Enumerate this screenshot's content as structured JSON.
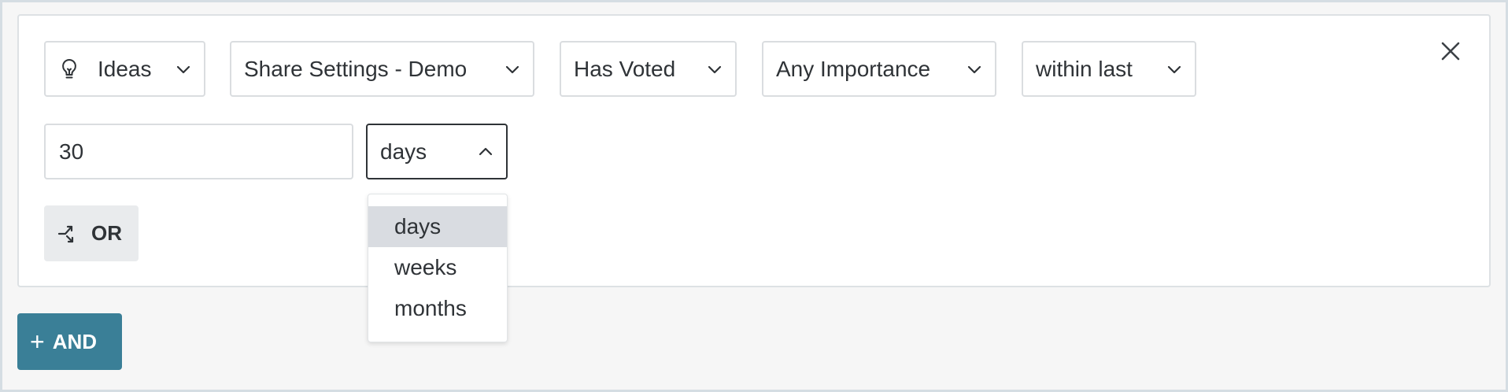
{
  "filters": {
    "entity": {
      "label": "Ideas",
      "icon": "lightbulb-icon"
    },
    "source": {
      "label": "Share Settings - Demo"
    },
    "condition": {
      "label": "Has Voted"
    },
    "importance": {
      "label": "Any Importance"
    },
    "time_operator": {
      "label": "within last"
    },
    "amount": {
      "value": "30"
    },
    "unit": {
      "label": "days",
      "expanded": true
    }
  },
  "unit_options": {
    "items": [
      "days",
      "weeks",
      "months"
    ],
    "selected": "days"
  },
  "buttons": {
    "or_label": "OR",
    "and_plus": "+",
    "and_label": "AND"
  },
  "colors": {
    "accent": "#3a7f97",
    "or_button_bg": "#e9ebed",
    "selected_option_bg": "#d9dce1",
    "text": "#2f3337"
  }
}
